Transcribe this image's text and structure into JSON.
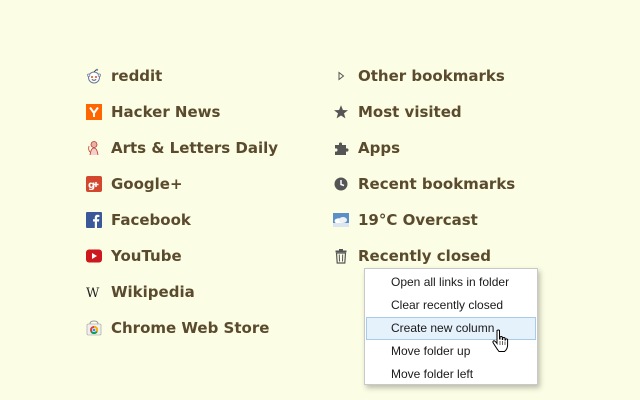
{
  "left_links": [
    {
      "label": "reddit",
      "icon": "reddit-icon"
    },
    {
      "label": "Hacker News",
      "icon": "hacker-news-icon"
    },
    {
      "label": "Arts & Letters Daily",
      "icon": "arts-letters-icon"
    },
    {
      "label": "Google+",
      "icon": "google-plus-icon"
    },
    {
      "label": "Facebook",
      "icon": "facebook-icon"
    },
    {
      "label": "YouTube",
      "icon": "youtube-icon"
    },
    {
      "label": "Wikipedia",
      "icon": "wikipedia-icon"
    },
    {
      "label": "Chrome Web Store",
      "icon": "chrome-web-store-icon"
    }
  ],
  "right_links": [
    {
      "label": "Other bookmarks",
      "icon": "triangle-right-icon"
    },
    {
      "label": "Most visited",
      "icon": "star-icon"
    },
    {
      "label": "Apps",
      "icon": "puzzle-icon"
    },
    {
      "label": "Recent bookmarks",
      "icon": "clock-icon"
    },
    {
      "label": "19°C Overcast",
      "icon": "weather-icon"
    },
    {
      "label": "Recently closed",
      "icon": "trash-icon"
    }
  ],
  "context_menu": {
    "items": [
      "Open all links in folder",
      "Clear recently closed",
      "Create new column",
      "Move folder up",
      "Move folder left"
    ],
    "hovered": "Create new column"
  },
  "colors": {
    "background": "#fbfde4",
    "link_text": "#5a4a2e",
    "menu_hover": "#e5f1fb"
  }
}
